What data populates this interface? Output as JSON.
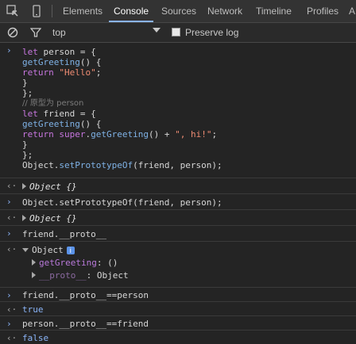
{
  "toolbar": {
    "tabs": [
      {
        "label": "Elements"
      },
      {
        "label": "Console"
      },
      {
        "label": "Sources"
      },
      {
        "label": "Network"
      },
      {
        "label": "Timeline"
      },
      {
        "label": "Profiles"
      },
      {
        "label": "A"
      }
    ],
    "active_tab": "Console",
    "accent_color": "#8ab4f8"
  },
  "filterbar": {
    "context": "top",
    "preserve_log_label": "Preserve log",
    "preserve_log_checked": false
  },
  "console": {
    "block1": [
      "let person = {",
      "getGreeting() {",
      "return \"Hello\";",
      "}",
      "};",
      "// 原型为 person",
      "let friend = {",
      "getGreeting() {",
      "return super.getGreeting() + \", hi!\";",
      "}",
      "};",
      "Object.setPrototypeOf(friend, person);"
    ],
    "result1": "Object {}",
    "input2": "Object.setPrototypeOf(friend, person);",
    "result2": "Object {}",
    "input3": "friend.__proto__",
    "result3": {
      "label": "Object",
      "info": "i",
      "children": [
        {
          "key": "getGreeting",
          "value": "()"
        },
        {
          "key": "__proto__",
          "value": "Object"
        }
      ]
    },
    "input4": "friend.__proto__==person",
    "result4": "true",
    "input5": "person.__proto__==friend",
    "result5": "false"
  }
}
